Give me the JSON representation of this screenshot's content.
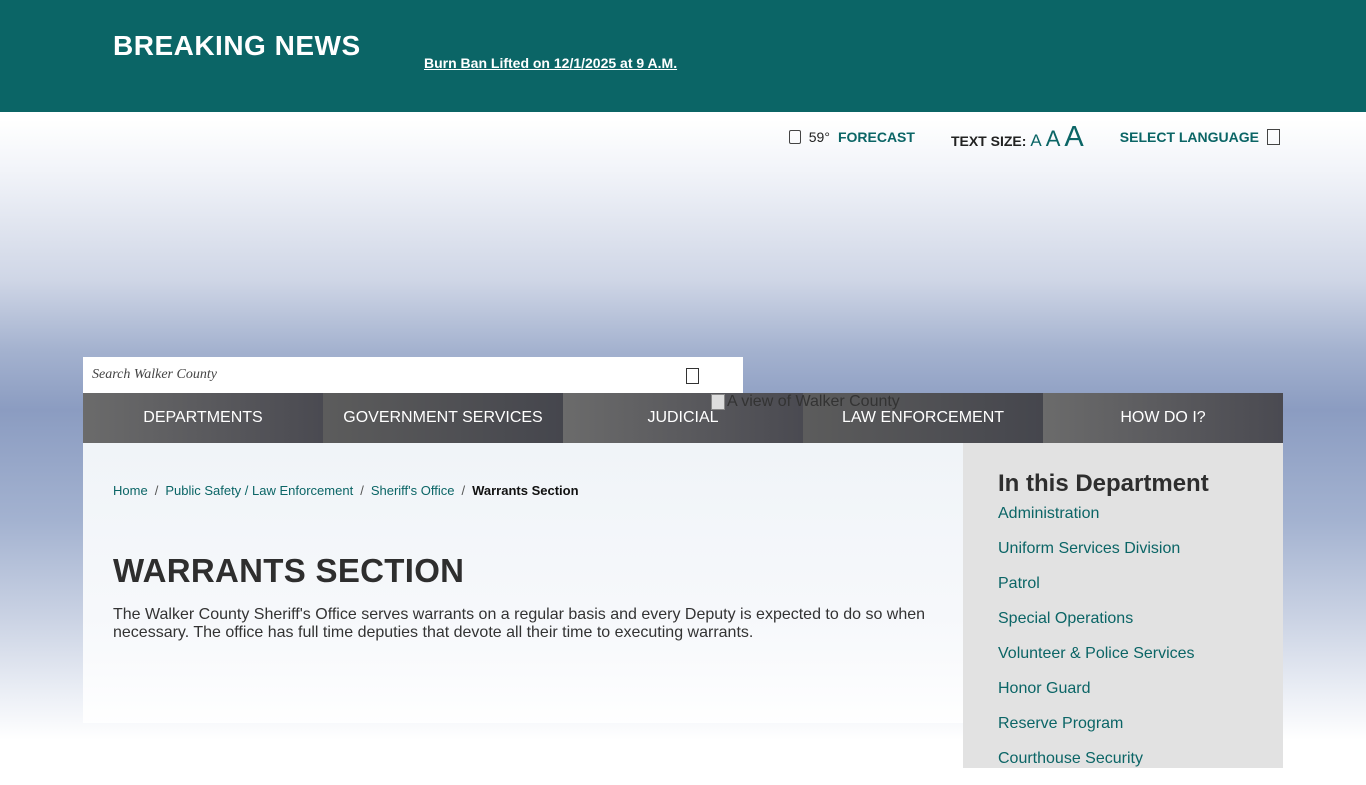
{
  "alert": {
    "title": "BREAKING NEWS",
    "link": "Burn Ban Lifted on 12/1/2025 at 9 A.M."
  },
  "utility": {
    "weather_icon": "cloud-icon",
    "temperature": "59°",
    "forecast": "FORECAST",
    "text_size_label": "TEXT SIZE:",
    "text_size_small": "A",
    "text_size_medium": "A",
    "text_size_large": "A",
    "language": "SELECT LANGUAGE",
    "language_icon": "globe-icon"
  },
  "search": {
    "placeholder": "Search Walker County",
    "icon": "search-icon"
  },
  "nav": {
    "items": [
      {
        "label": "DEPARTMENTS"
      },
      {
        "label": "GOVERNMENT SERVICES"
      },
      {
        "label": "JUDICIAL"
      },
      {
        "label": "LAW ENFORCEMENT"
      },
      {
        "label": "HOW DO I?"
      }
    ]
  },
  "banner_image_alt": "A view of Walker County",
  "breadcrumb": {
    "items": [
      "Home",
      "Public Safety / Law Enforcement",
      "Sheriff's Office"
    ],
    "current": "Warrants Section",
    "separator": "/"
  },
  "page": {
    "title": "WARRANTS SECTION",
    "body": "The Walker County Sheriff's Office serves warrants on a regular basis and every Deputy is expected to do so when necessary. The office has full time deputies that devote all their time to executing warrants."
  },
  "sidebar": {
    "title": "In this Department",
    "items": [
      "Administration",
      "Uniform Services Division",
      "Patrol",
      "Special Operations",
      "Volunteer & Police Services",
      "Honor Guard",
      "Reserve Program",
      "Courthouse Security"
    ]
  },
  "colors": {
    "brand": "#0b6566",
    "nav_bg": "#5a5a60",
    "sidebar_bg": "#e2e2e2"
  }
}
